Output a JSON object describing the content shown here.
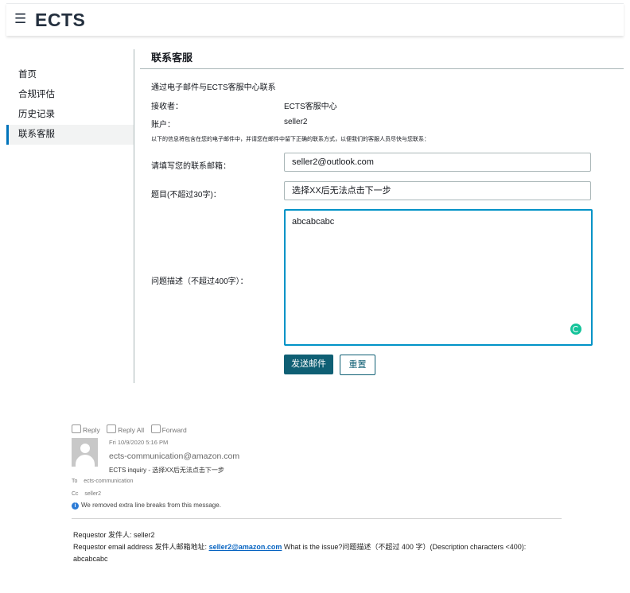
{
  "header": {
    "menu_icon": "hamburger-icon",
    "brand": "ECTS"
  },
  "sidebar": {
    "items": [
      {
        "label": "首页",
        "active": false
      },
      {
        "label": "合规评估",
        "active": false
      },
      {
        "label": "历史记录",
        "active": false
      },
      {
        "label": "联系客服",
        "active": true
      }
    ]
  },
  "contact": {
    "title": "联系客服",
    "intro": "通过电子邮件与ECTS客服中心联系",
    "recipient_label": "接收者：",
    "recipient_value": "ECTS客服中心",
    "account_label": "账户：",
    "account_value": "seller2",
    "note": "以下的信息将包含在您的电子邮件中，并请您在邮件中留下正确的联系方式，以便我们的客服人员尽快与您联系：",
    "email_label": "请填写您的联系邮箱：",
    "email_value": "seller2@outlook.com",
    "subject_label": "题目(不超过30字)：",
    "subject_value": "选择XX后无法点击下一步",
    "desc_label": "问题描述（不超过400字）：",
    "desc_value": "abcabcabc",
    "send_label": "发送邮件",
    "reset_label": "重置"
  },
  "email": {
    "actions": [
      "Reply",
      "Reply All",
      "Forward"
    ],
    "date": "Fri 10/9/2020 5:16 PM",
    "from": "ects-communication@amazon.com",
    "subject": "ECTS inquiry - 选择XX后无法点击下一步",
    "to_label": "To",
    "to_value": "ects-communication",
    "cc_label": "Cc",
    "cc_value": "seller2",
    "info": "We removed extra line breaks from this message.",
    "body_line1": "Requestor 发件人: seller2",
    "body_line2_prefix": "Requestor email address 发件人邮箱地址: ",
    "body_link": "seller2@amazon.com",
    "body_line2_suffix": " What is the issue?问题描述（不超过 400 字）(Description characters <400):",
    "body_line3": "abcabcabc"
  },
  "colors": {
    "primary": "#0f5f74",
    "focus": "#0093c7",
    "active_nav": "#0073bb",
    "grammar": "#15c39a"
  }
}
